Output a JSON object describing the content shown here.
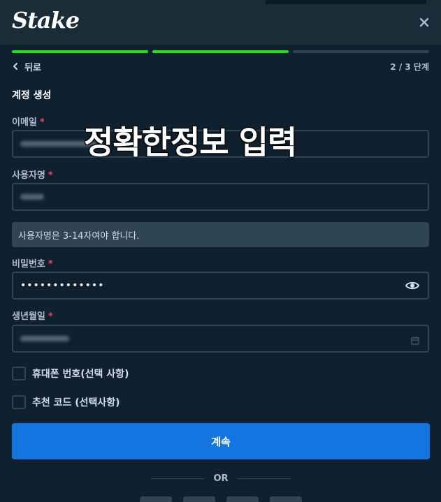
{
  "header": {
    "logo_text": "Stake",
    "close_icon": "close-icon"
  },
  "progress": {
    "total_steps": 3,
    "completed_steps": 2
  },
  "nav": {
    "back_label": "뒤로",
    "step_text": "2 / 3 단계"
  },
  "form": {
    "title": "계정 생성",
    "email": {
      "label": "이메일",
      "required_mark": "*"
    },
    "username": {
      "label": "사용자명",
      "required_mark": "*",
      "hint": "사용자명은 3-14자여야 합니다."
    },
    "password": {
      "label": "비밀번호",
      "required_mark": "*",
      "value_masked": "•••••••••••••",
      "toggle_icon": "eye-icon"
    },
    "birthdate": {
      "label": "생년월일",
      "required_mark": "*",
      "calendar_icon": "calendar-icon"
    },
    "phone_checkbox": {
      "label": "휴대폰 번호(선택 사항)",
      "checked": false
    },
    "referral_checkbox": {
      "label": "추천 코드 (선택사항)",
      "checked": false
    },
    "submit_label": "계속"
  },
  "divider": {
    "text": "OR"
  },
  "overlay": {
    "caption": "정확한정보 입력"
  },
  "colors": {
    "background": "#0f212e",
    "header": "#1a2c38",
    "progress_done": "#21e21a",
    "button": "#1475e1",
    "required": "#ed4163"
  }
}
